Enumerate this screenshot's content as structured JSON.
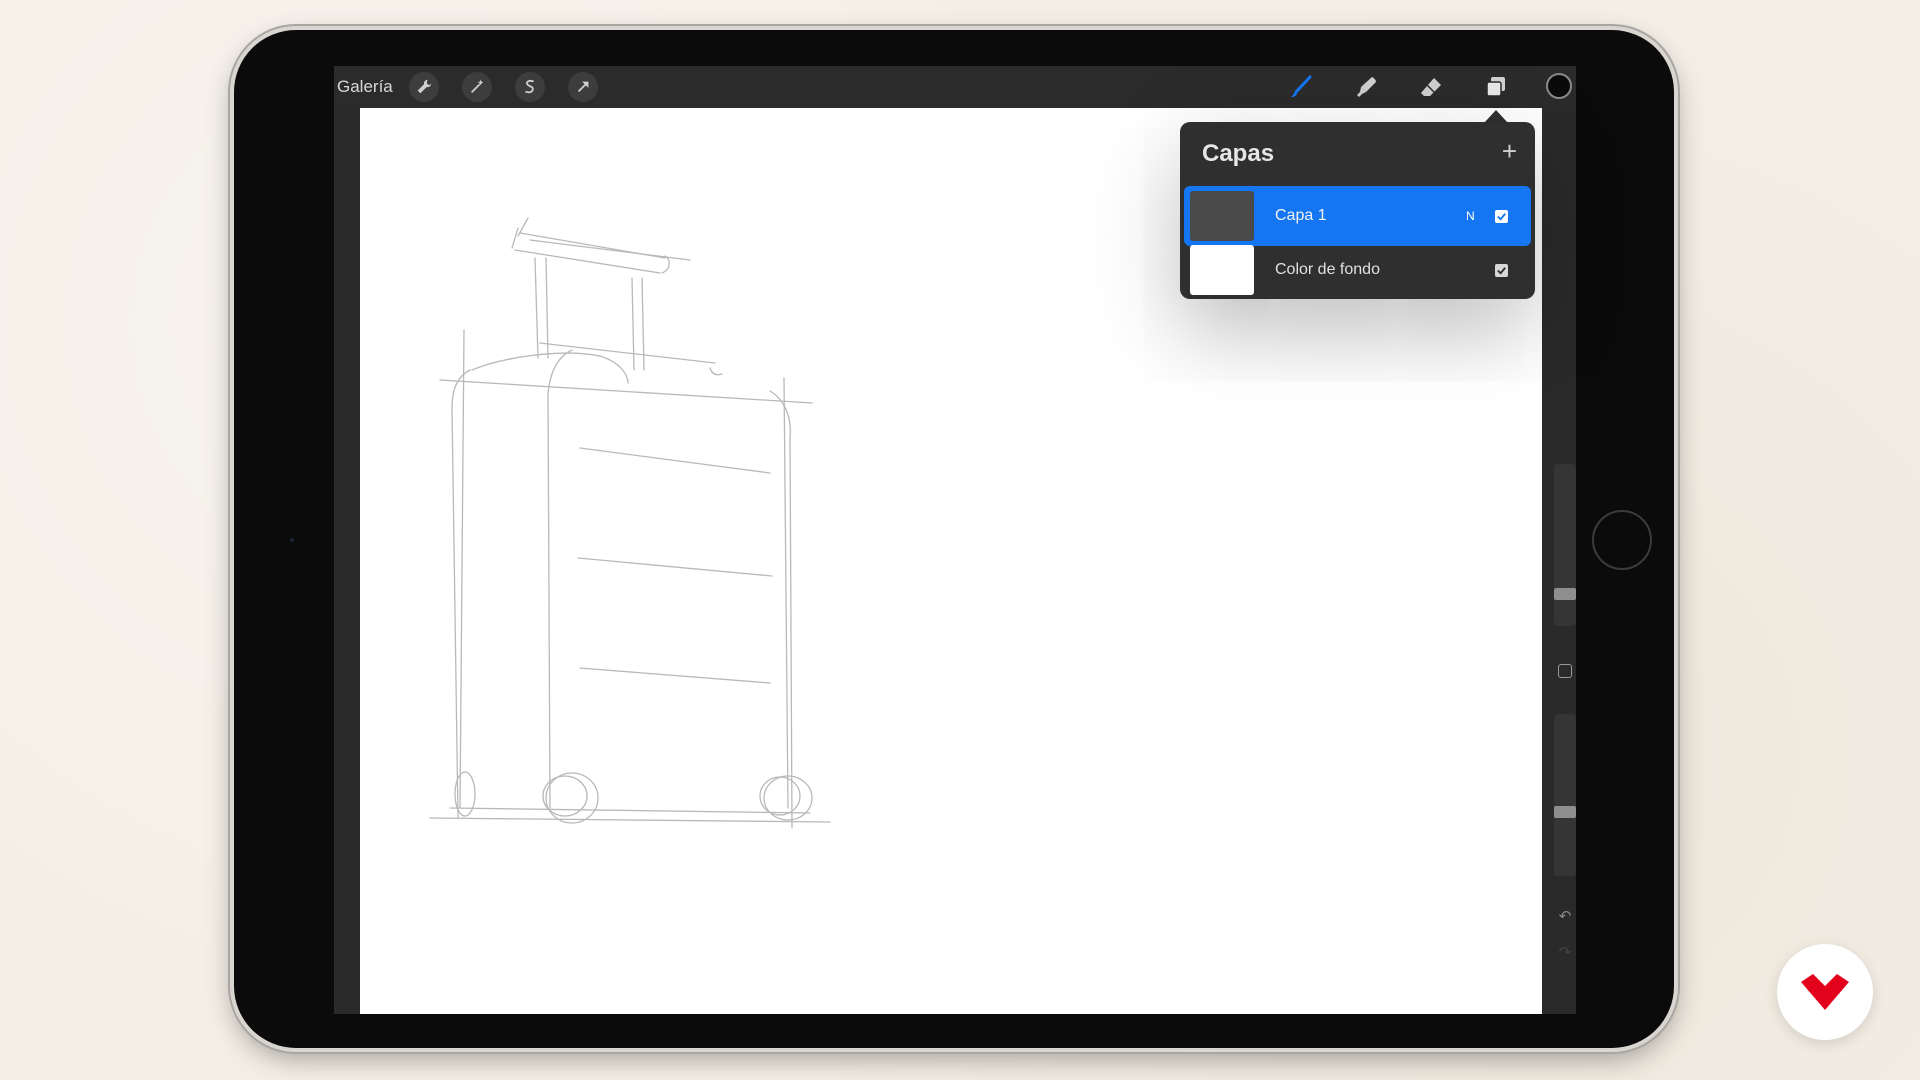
{
  "toolbar": {
    "gallery_label": "Galería",
    "left_tools": [
      "wrench-icon",
      "magic-wand-icon",
      "selection-icon",
      "transform-arrow-icon"
    ],
    "right_tools": [
      "brush-icon",
      "smudge-icon",
      "eraser-icon",
      "layers-icon"
    ],
    "active_tool": "brush-icon",
    "accent_color": "#1476f2",
    "current_color": "#0b0b0b"
  },
  "layers_panel": {
    "title": "Capas",
    "add_symbol": "+",
    "layers": [
      {
        "name": "Capa 1",
        "blend_mode": "N",
        "visible": true,
        "selected": true,
        "thumb_color": "#4a4a4a"
      },
      {
        "name": "Color de fondo",
        "blend_mode": "",
        "visible": true,
        "selected": false,
        "thumb_color": "#ffffff"
      }
    ]
  },
  "sidebar": {
    "brush_size": 0.25,
    "opacity": 0.35,
    "undo_icon": "undo-icon",
    "redo_icon": "redo-icon"
  },
  "canvas": {
    "sketch": "suitcase-pencil-sketch"
  },
  "brand": {
    "logo": "domestika-logo",
    "color": "#e3021b"
  }
}
